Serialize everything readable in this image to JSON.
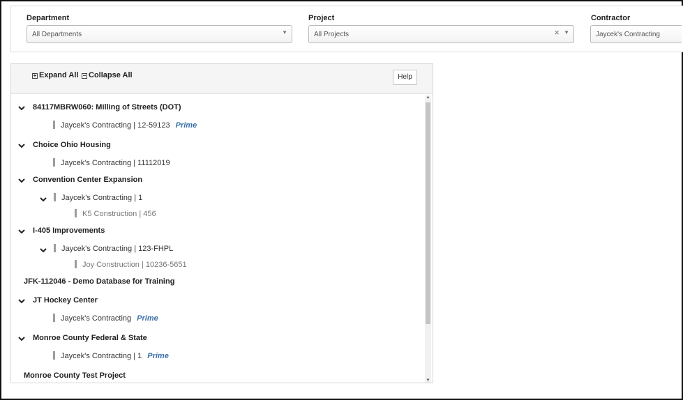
{
  "filters": {
    "department": {
      "label": "Department",
      "value": "All Departments"
    },
    "project": {
      "label": "Project",
      "value": "All Projects",
      "clear": "×"
    },
    "contractor": {
      "label": "Contractor",
      "value": "Jaycek's Contracting"
    }
  },
  "toolbar": {
    "expand_all": "Expand All",
    "collapse_all": "Collapse All",
    "help": "Help"
  },
  "tree": {
    "p1": {
      "name": "84117MBRW060: Milling of Streets (DOT)",
      "c1": "Jaycek's Contracting | 12-59123",
      "c1_badge": "Prime"
    },
    "p2": {
      "name": "Choice Ohio Housing",
      "c1": "Jaycek's Contracting | 11112019"
    },
    "p3": {
      "name": "Convention Center Expansion",
      "c1": "Jaycek's Contracting | 1",
      "g1": "K5 Construction | 456"
    },
    "p4": {
      "name": "I-405 Improvements",
      "c1": "Jaycek's Contracting | 123-FHPL",
      "g1": "Joy Construction | 10236-5651"
    },
    "p5": {
      "name": "JFK-112046 - Demo Database for Training"
    },
    "p6": {
      "name": "JT Hockey Center",
      "c1": "Jaycek's Contracting",
      "c1_badge": "Prime"
    },
    "p7": {
      "name": "Monroe County Federal & State",
      "c1": "Jaycek's Contracting | 1",
      "c1_badge": "Prime"
    },
    "p8": {
      "name": "Monroe County Test Project"
    }
  },
  "colors": {
    "highlight": "#fcfc4f",
    "prime": "#3a6fa8"
  }
}
